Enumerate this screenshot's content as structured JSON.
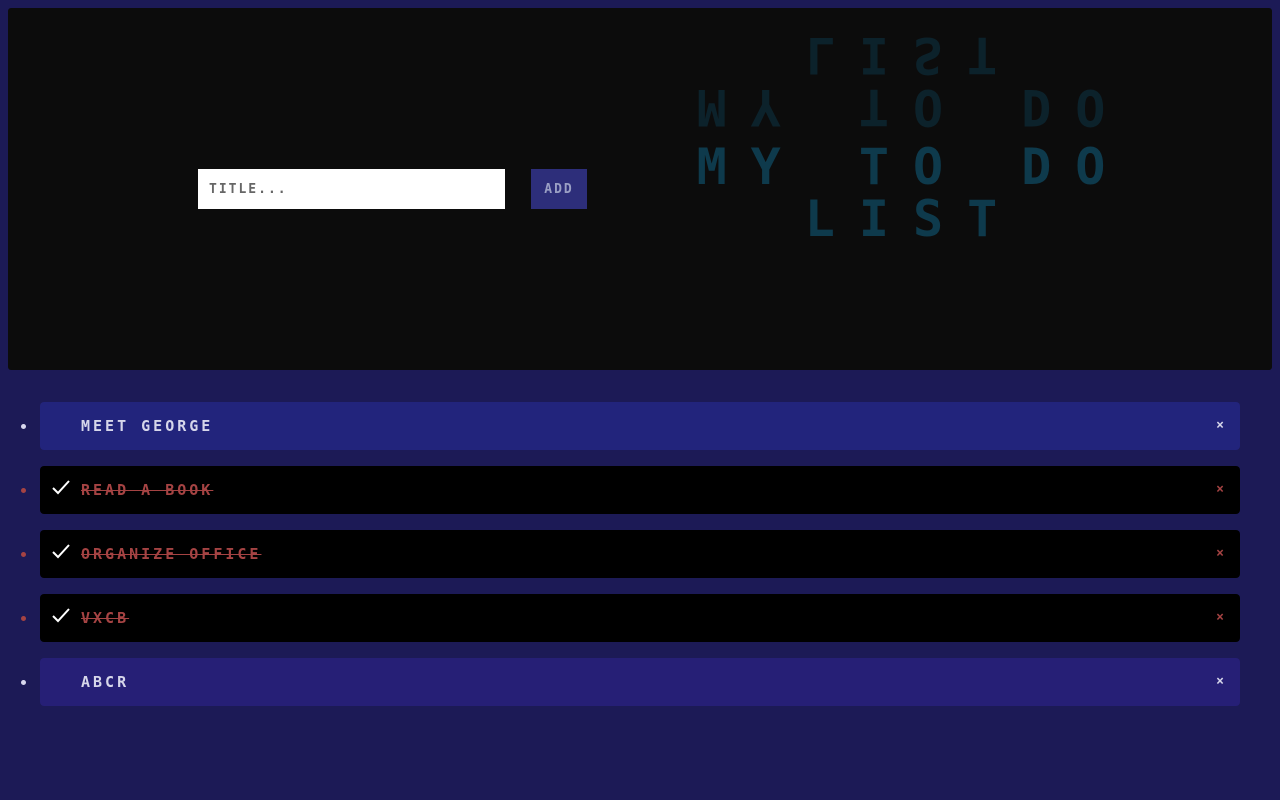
{
  "form": {
    "input_placeholder": "TITLE...",
    "input_value": "",
    "add_label": "ADD"
  },
  "header": {
    "title": "MY TO DO LIST"
  },
  "todos": [
    {
      "text": "MEET GEORGE",
      "done": false,
      "delete_label": "×"
    },
    {
      "text": "READ A BOOK",
      "done": true,
      "delete_label": "×"
    },
    {
      "text": "ORGANIZE OFFICE",
      "done": true,
      "delete_label": "×"
    },
    {
      "text": "VXCB",
      "done": true,
      "delete_label": "×"
    },
    {
      "text": "ABCR",
      "done": false,
      "delete_label": "×"
    }
  ],
  "colors": {
    "page_background": "#1c1a56",
    "panel_background": "#0c0c0c",
    "heading": "#0e3a4c",
    "active_item": "#22247c",
    "done_item": "#000000",
    "done_text": "#a54343",
    "add_button": "#2d2e7a"
  },
  "icons": {
    "check": "checkmark-icon",
    "delete": "close-icon"
  }
}
